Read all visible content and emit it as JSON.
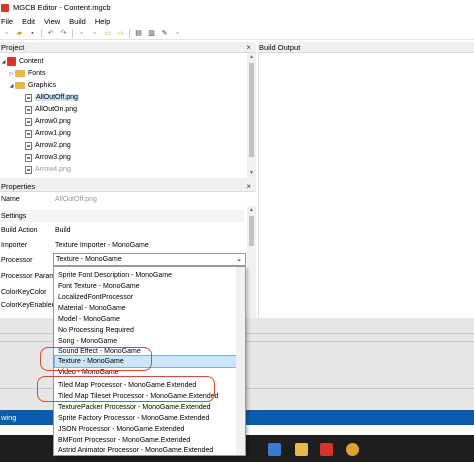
{
  "window": {
    "title": "MGCB Editor - Content.mgcb"
  },
  "menu": {
    "items": [
      "File",
      "Edit",
      "View",
      "Build",
      "Help"
    ]
  },
  "toolbar": {
    "icons": [
      "new-icon",
      "open-icon",
      "save-icon",
      "undo-icon",
      "redo-icon",
      "add-new-item-icon",
      "add-existing-item-icon",
      "new-folder-icon",
      "add-existing-folder-icon",
      "build-icon",
      "rebuild-icon",
      "clean-icon",
      "cancel-build-icon"
    ]
  },
  "project": {
    "header": "Project",
    "tree": [
      {
        "label": "Content",
        "kind": "content",
        "arrow": "◢"
      },
      {
        "label": "Fonts",
        "kind": "folder",
        "arrow": "▷"
      },
      {
        "label": "Graphics",
        "kind": "folder",
        "arrow": "◢"
      },
      {
        "label": "AllOutOff.png",
        "kind": "file",
        "selected": true
      },
      {
        "label": "AllOutOn.png",
        "kind": "file"
      },
      {
        "label": "Arrow0.png",
        "kind": "file"
      },
      {
        "label": "Arrow1.png",
        "kind": "file"
      },
      {
        "label": "Arrow2.png",
        "kind": "file"
      },
      {
        "label": "Arrow3.png",
        "kind": "file"
      },
      {
        "label": "Arrow4.png",
        "kind": "file"
      }
    ]
  },
  "build_output": {
    "header": "Build Output"
  },
  "properties": {
    "header": "Properties",
    "name_label": "Name",
    "name_value": "AllOutOff.png",
    "section_settings": "Settings",
    "build_action_label": "Build Action",
    "build_action_value": "Build",
    "importer_label": "Importer",
    "importer_value": "Texture Importer - MonoGame",
    "processor_label": "Processor",
    "processor_value": "Texture - MonoGame",
    "processor_params_label": "Processor Parameters",
    "color_key_color_label": "ColorKeyColor",
    "color_key_enabled_label": "ColorKeyEnabled"
  },
  "processor_dropdown": {
    "options": [
      "Sprite Font Description - MonoGame",
      "Font Texture - MonoGame",
      "LocalizedFontProcessor",
      "Material - MonoGame",
      "Model - MonoGame",
      "No Processing Required",
      "Song - MonoGame",
      "Sound Effect - MonoGame",
      "Texture - MonoGame",
      "Video - MonoGame",
      "Tiled Map Processor - MonoGame.Extended",
      "Tiled Map Tileset Processor - MonoGame.Extended",
      "TexturePacker Processor - MonoGame.Extended",
      "Sprite Factory Processor - MonoGame.Extended",
      "JSON Processor - MonoGame.Extended",
      "BMFont Processor - MonoGame.Extended",
      "Astrid Animator Processor - MonoGame.Extended"
    ],
    "highlighted_index": 8
  },
  "status": {
    "text": "wing"
  },
  "colors": {
    "accent": "#0a5dab",
    "annotation": "#d2502e",
    "selection": "#cde5f7",
    "brand": "#d9342b"
  }
}
